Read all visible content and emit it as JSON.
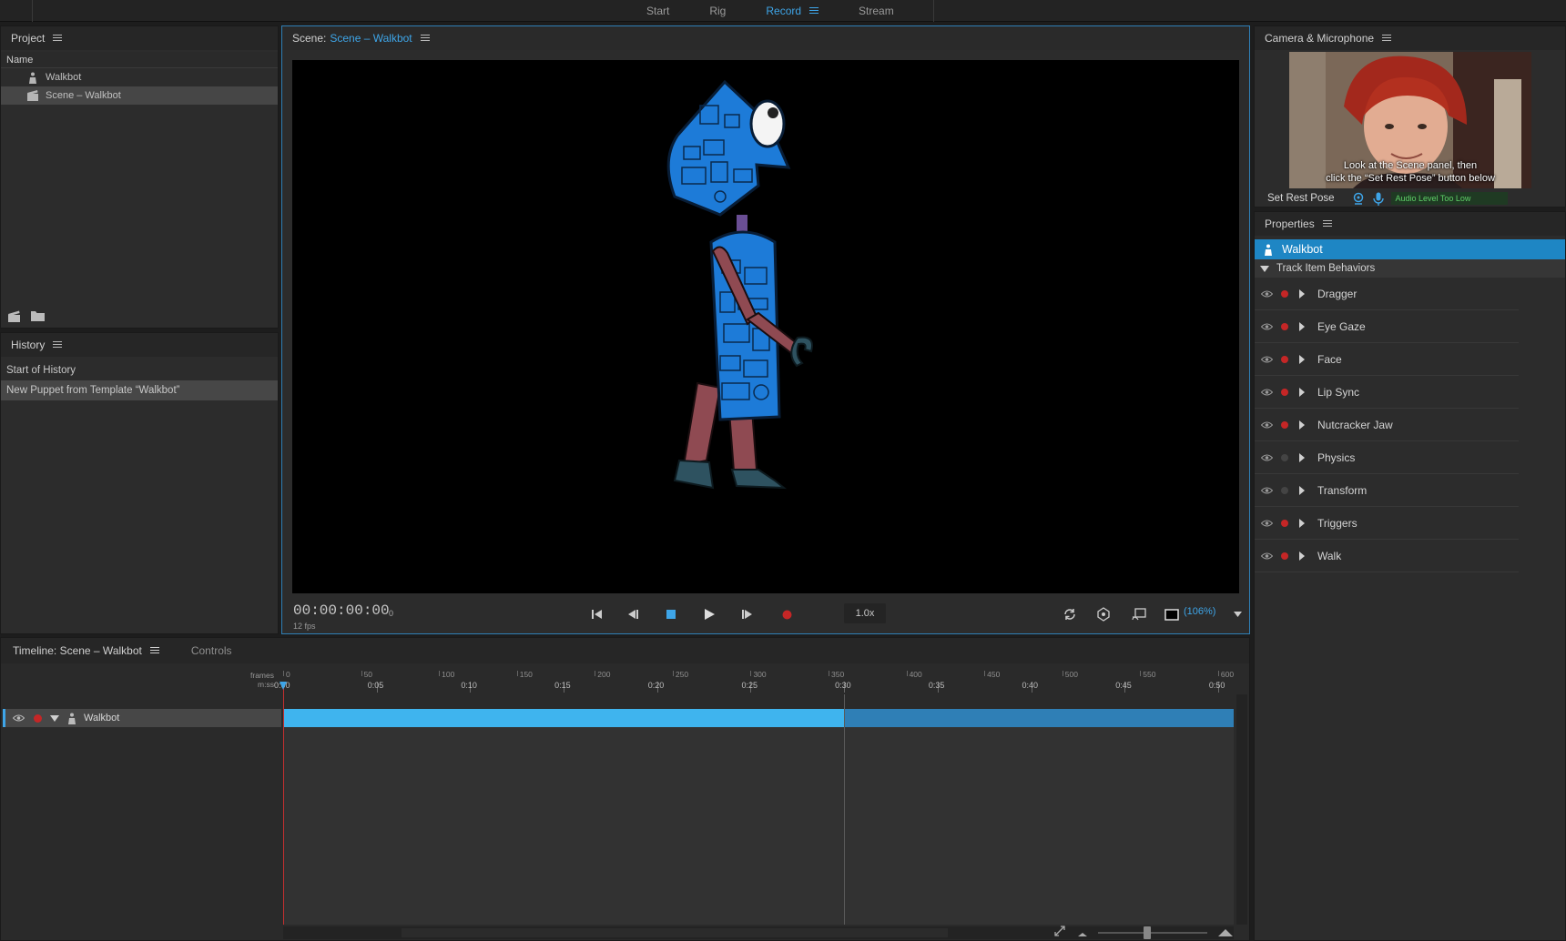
{
  "workspaces": [
    {
      "label": "Start"
    },
    {
      "label": "Rig"
    },
    {
      "label": "Record"
    },
    {
      "label": "Stream"
    }
  ],
  "project": {
    "title": "Project",
    "column": "Name",
    "items": [
      {
        "label": "Walkbot",
        "icon": "puppet-icon"
      },
      {
        "label": "Scene – Walkbot",
        "icon": "scene-icon"
      }
    ]
  },
  "history": {
    "title": "History",
    "items": [
      "Start of History",
      "New Puppet from Template “Walkbot”"
    ]
  },
  "scene": {
    "prefix": "Scene:",
    "name": "Scene – Walkbot",
    "timecode": "00:00:00:00",
    "frame": "0",
    "fps": "12 fps",
    "speed": "1.0x",
    "zoom": "(106%)"
  },
  "camera": {
    "title": "Camera & Microphone",
    "message_line1": "Look at the Scene panel, then",
    "message_line2": "click the “Set Rest Pose” button below",
    "rest_pose": "Set Rest Pose",
    "audio_level": "Audio Level Too Low"
  },
  "properties": {
    "title": "Properties",
    "selected": "Walkbot",
    "group": "Track Item Behaviors",
    "behaviors": [
      {
        "label": "Dragger",
        "armed": true
      },
      {
        "label": "Eye Gaze",
        "armed": true
      },
      {
        "label": "Face",
        "armed": true
      },
      {
        "label": "Lip Sync",
        "armed": true
      },
      {
        "label": "Nutcracker Jaw",
        "armed": true
      },
      {
        "label": "Physics",
        "armed": false
      },
      {
        "label": "Transform",
        "armed": false
      },
      {
        "label": "Triggers",
        "armed": true
      },
      {
        "label": "Walk",
        "armed": true
      }
    ]
  },
  "timeline": {
    "tab": "Timeline: Scene – Walkbot",
    "tab2": "Controls",
    "ruler_frames_label": "frames",
    "ruler_time_label": "m:ss",
    "frame_ticks": [
      "0",
      "50",
      "100",
      "150",
      "200",
      "250",
      "300",
      "350",
      "400",
      "450",
      "500",
      "550",
      "600"
    ],
    "time_ticks": [
      "0:00",
      "0:05",
      "0:10",
      "0:15",
      "0:20",
      "0:25",
      "0:30",
      "0:35",
      "0:40",
      "0:45",
      "0:50"
    ],
    "track": "Walkbot",
    "scene_end_frame": 360,
    "max_frame": 610
  },
  "colors": {
    "accent": "#3ea5e8",
    "selection": "#1e86c4",
    "record": "#c52626",
    "audio_ok": "#5fd068"
  }
}
